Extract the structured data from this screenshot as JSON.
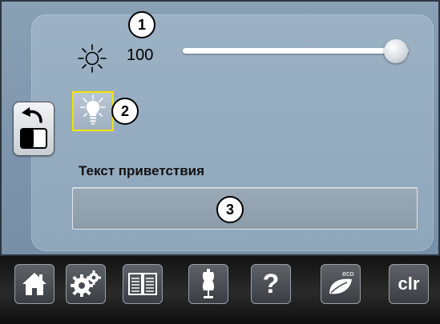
{
  "display": {
    "brightness_value": "100",
    "brightness_level": 1.0
  },
  "badges": {
    "b1": "1",
    "b2": "2",
    "b3": "3"
  },
  "greeting": {
    "label": "Текст приветствия",
    "value": ""
  },
  "toolbar": {
    "clr_label": "clr",
    "help_label": "?",
    "eco_label": "eco"
  },
  "icons": {
    "brightness": "sun-icon",
    "light": "bulb-icon",
    "back": "undo-arrow-icon",
    "home": "home-icon",
    "settings": "gears-icon",
    "manual": "book-icon",
    "tutorial": "dress-form-icon",
    "help": "question-icon",
    "eco": "leaf-eco-icon"
  },
  "colors": {
    "highlight_border": "#f3e400"
  }
}
